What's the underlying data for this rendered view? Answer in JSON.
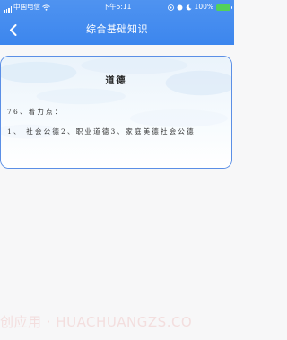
{
  "status_bar": {
    "carrier": "中国电信",
    "time": "下午5:11",
    "battery_text": "100%"
  },
  "nav": {
    "title": "综合基础知识"
  },
  "card": {
    "title": "道德",
    "line1": "76、着力点：",
    "line2": "1、 社会公德2、职业道德3、家庭美德社会公德"
  },
  "watermark": {
    "text": "创应用 · HUACHUANGZS.CO"
  },
  "colors": {
    "header": "#3c86ee",
    "card_border": "#5b8fe6",
    "background": "#f7f7f8"
  }
}
